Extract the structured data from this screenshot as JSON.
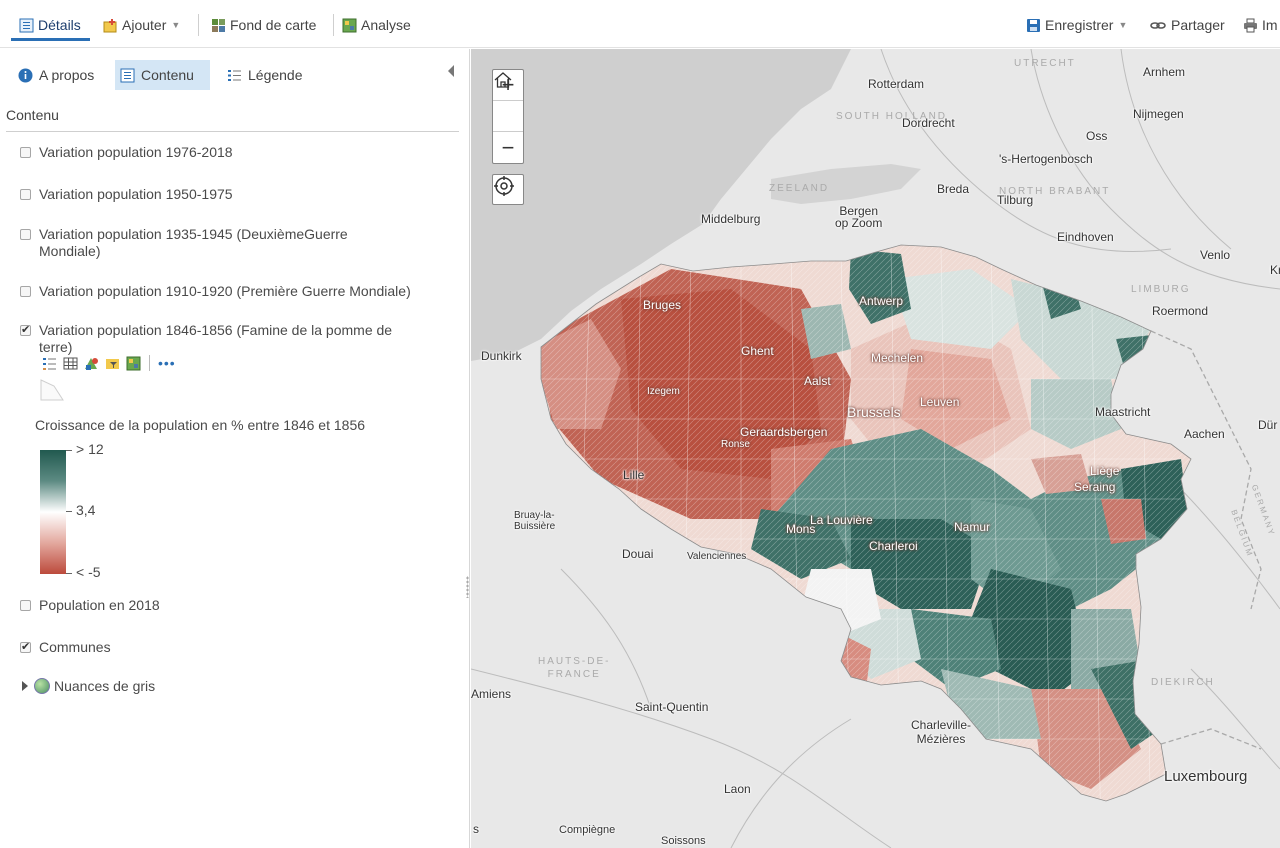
{
  "toolbar": {
    "details": "Détails",
    "add": "Ajouter",
    "basemap": "Fond de carte",
    "analysis": "Analyse",
    "save": "Enregistrer",
    "share": "Partager",
    "print": "Im"
  },
  "panel": {
    "tabs": {
      "about": "A propos",
      "content": "Contenu",
      "legend": "Légende"
    },
    "section_title": "Contenu",
    "layers": [
      {
        "label": "Variation population 1976-2018",
        "checked": false
      },
      {
        "label": "Variation population 1950-1975",
        "checked": false
      },
      {
        "label": "Variation population 1935-1945 (DeuxièmeGuerre Mondiale)",
        "checked": false
      },
      {
        "label": "Variation population 1910-1920 (Première Guerre Mondiale)",
        "checked": false
      },
      {
        "label": "Variation population 1846-1856 (Famine de la pomme de terre)",
        "checked": true
      },
      {
        "label": "Population en 2018",
        "checked": false
      },
      {
        "label": "Communes",
        "checked": true
      }
    ],
    "legend": {
      "title": "Croissance de la population en % entre 1846 et 1856",
      "high": "> 12",
      "mid": "3,4",
      "low": "< -5",
      "colors": {
        "high": "#21594f",
        "mid": "#ffffff",
        "low": "#bc4a3c"
      }
    },
    "basemap_layer": "Nuances de gris"
  },
  "map": {
    "controls": {
      "zoom_in": "+",
      "zoom_out": "−"
    },
    "labels": {
      "rotterdam": "Rotterdam",
      "utrecht": "UTRECHT",
      "arnhem": "Arnhem",
      "south_holland": "SOUTH HOLLAND",
      "dordrecht": "Dordrecht",
      "nijmegen": "Nijmegen",
      "oss": "Oss",
      "hertogenbosch": "'s-Hertogenbosch",
      "zeeland": "ZEELAND",
      "breda": "Breda",
      "north_brabant": "NORTH BRABANT",
      "tilburg": "Tilburg",
      "middelburg": "Middelburg",
      "bergen": "Bergen\nop Zoom",
      "eindhoven": "Eindhoven",
      "venlo": "Venlo",
      "kr": "Kr",
      "limburg": "LIMBURG",
      "roermond": "Roermond",
      "bruges": "Bruges",
      "antwerp": "Antwerp",
      "dunkirk": "Dunkirk",
      "ghent": "Ghent",
      "mechelen": "Mechelen",
      "aalst": "Aalst",
      "izegem": "Izegem",
      "leuven": "Leuven",
      "brussels": "Brussels",
      "maastricht": "Maastricht",
      "geraardsbergen": "Geraardsbergen",
      "ronse": "Ronse",
      "aachen": "Aachen",
      "dur": "Dür",
      "lille": "Lille",
      "liege": "Liège",
      "seraing": "Seraing",
      "bruay": "Bruay-la-\nBuissière",
      "la_louviere": "La Louvière",
      "mons": "Mons",
      "namur": "Namur",
      "germany": "GERMANY",
      "belgium": "BELGIUM",
      "douai": "Douai",
      "valenciennes": "Valenciennes",
      "charleroi": "Charleroi",
      "hauts_de_france": "HAUTS-DE-\nFRANCE",
      "amiens": "Amiens",
      "diekirch": "DIEKIRCH",
      "saint_quentin": "Saint-Quentin",
      "charleville": "Charleville-\nMézières",
      "luxembourg": "Luxembourg",
      "laon": "Laon",
      "s": "s",
      "compiegne": "Compiègne",
      "soissons": "Soissons"
    }
  }
}
